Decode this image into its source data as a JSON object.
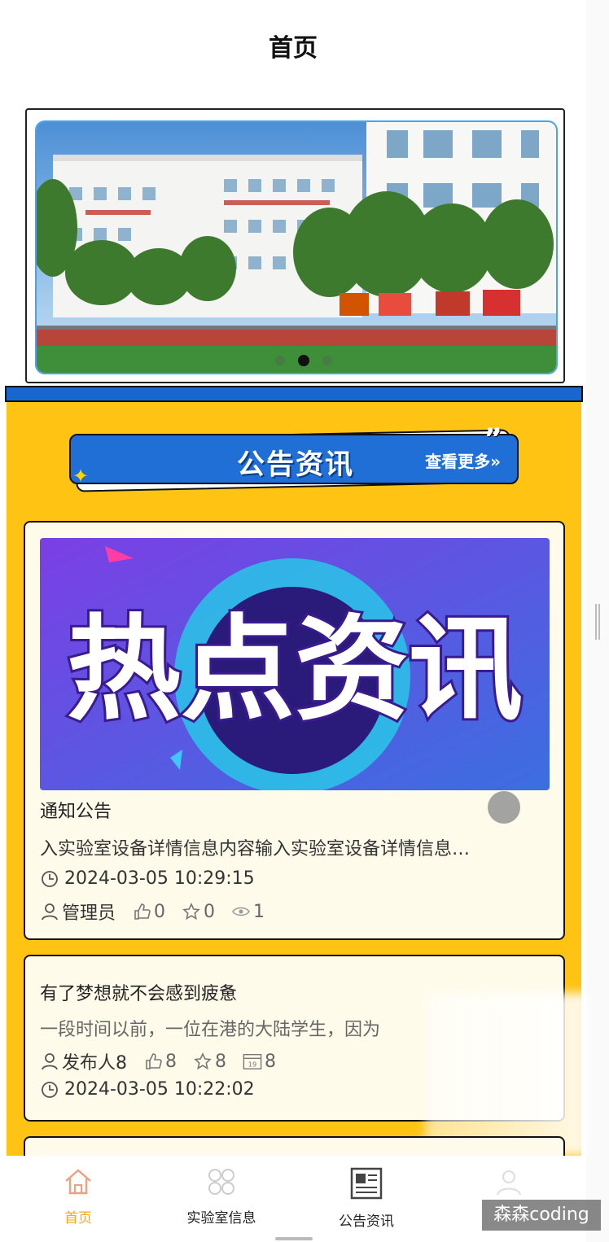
{
  "header": {
    "title": "首页"
  },
  "carousel": {
    "dots": 3,
    "active_index": 1,
    "image_alt": "school building"
  },
  "section": {
    "title": "公告资讯",
    "more_label": "查看更多",
    "quote_glyph": "”",
    "more_glyph": "»"
  },
  "cards": [
    {
      "banner_text": "热点资讯",
      "type": "通知公告",
      "desc": "入实验室设备详情信息内容输入实验室设备详情信息…",
      "time": "2024-03-05 10:29:15",
      "author": "管理员",
      "likes": "0",
      "favorites": "0",
      "views": "1"
    },
    {
      "title": "有了梦想就不会感到疲惫",
      "desc": "一段时间以前，一位在港的大陆学生，因为",
      "author": "发布人8",
      "likes": "8",
      "favorites": "8",
      "day": "8",
      "calendar_icon_text": "19",
      "time": "2024-03-05 10:22:02"
    }
  ],
  "tabbar": {
    "items": [
      {
        "label": "首页",
        "icon": "home-icon",
        "active": true
      },
      {
        "label": "实验室信息",
        "icon": "grid-icon",
        "active": false
      },
      {
        "label": "公告资讯",
        "icon": "news-icon",
        "active": false
      },
      {
        "label": "",
        "icon": "user-icon",
        "active": false
      }
    ]
  },
  "watermark": "森森coding",
  "colors": {
    "accent": "#fec313",
    "blue": "#1f6fd6",
    "active_tab": "#f5a623"
  }
}
